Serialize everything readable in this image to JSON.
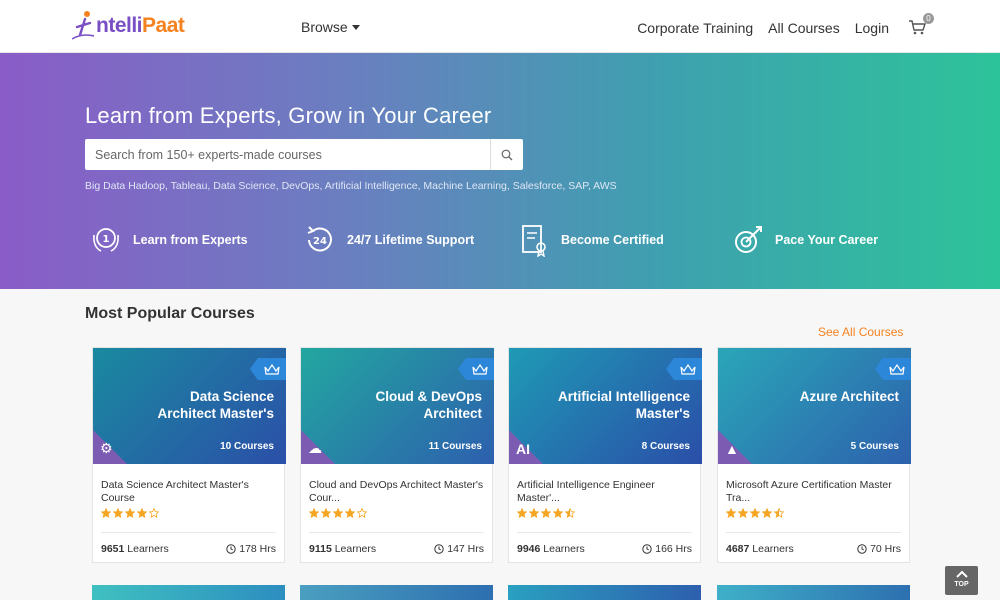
{
  "header": {
    "logo_main": "ntelli",
    "logo_accent": "Paat",
    "browse_label": "Browse",
    "nav": [
      "Corporate Training",
      "All Courses",
      "Login"
    ],
    "cart_count": "0"
  },
  "hero": {
    "title": "Learn from Experts, Grow in Your Career",
    "search_placeholder": "Search from 150+ experts-made courses",
    "tags": [
      "Big Data Hadoop",
      "Tableau",
      "Data Science",
      "DevOps",
      "Artificial Intelligence",
      "Machine Learning",
      "Salesforce",
      "SAP",
      "AWS"
    ],
    "features": [
      {
        "label": "Learn from Experts",
        "icon": "medal-icon"
      },
      {
        "label": "24/7 Lifetime Support",
        "icon": "support-24-icon"
      },
      {
        "label": "Become Certified",
        "icon": "certificate-icon"
      },
      {
        "label": "Pace Your Career",
        "icon": "target-icon"
      }
    ]
  },
  "popular": {
    "title": "Most Popular Courses",
    "see_all": "See All Courses",
    "courses": [
      {
        "thumb_line1": "Data Science",
        "thumb_line2": "Architect Master's",
        "count": "10 Courses",
        "corner": "⚙",
        "title": "Data Science Architect Master's Course",
        "rating": 4,
        "learners": "9651",
        "learners_label": "Learners",
        "hours": "178 Hrs",
        "bg": [
          "#1a8aa0",
          "#2b4fa8"
        ]
      },
      {
        "thumb_line1": "Cloud & DevOps",
        "thumb_line2": "Architect",
        "count": "11 Courses",
        "corner": "☁",
        "title": "Cloud and DevOps Architect Master's Cour...",
        "rating": 4,
        "learners": "9115",
        "learners_label": "Learners",
        "hours": "147 Hrs",
        "bg": [
          "#22a7a0",
          "#2d5fae"
        ]
      },
      {
        "thumb_line1": "Artificial Intelligence",
        "thumb_line2": "Master's",
        "count": "8 Courses",
        "corner": "AI",
        "title": "Artificial Intelligence Engineer Master'...",
        "rating": 4.5,
        "learners": "9946",
        "learners_label": "Learners",
        "hours": "166 Hrs",
        "bg": [
          "#1f9ab5",
          "#2a4ea8"
        ]
      },
      {
        "thumb_line1": "Azure Architect",
        "thumb_line2": "",
        "count": "5 Courses",
        "corner": "▲",
        "title": "Microsoft Azure Certification Master Tra...",
        "rating": 4.5,
        "learners": "4687",
        "learners_label": "Learners",
        "hours": "70 Hrs",
        "bg": [
          "#2aa6b8",
          "#2d61ad"
        ]
      }
    ]
  },
  "top_label": "TOP",
  "colors": {
    "accent": "#f58220",
    "brand": "#7a4fc4",
    "star": "#f5a623"
  }
}
